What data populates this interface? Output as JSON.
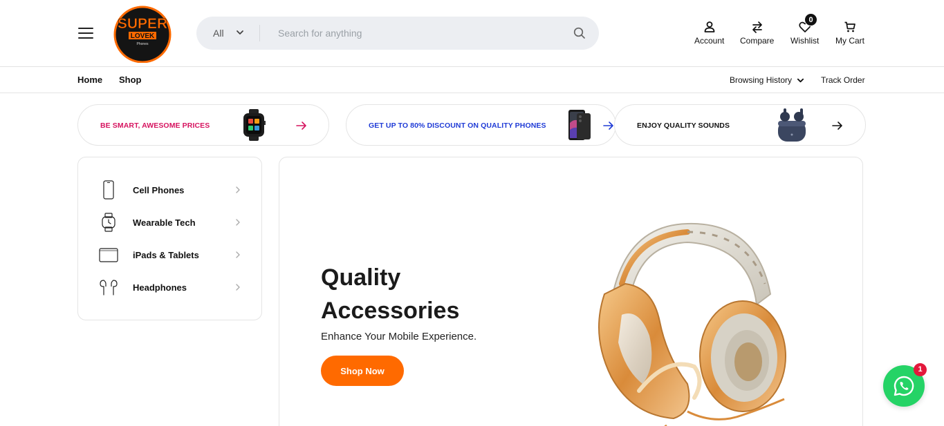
{
  "header": {
    "logo_text": {
      "line1": "SUPER",
      "line2": "LOVEK",
      "line3": "Phones"
    },
    "search": {
      "category": "All",
      "placeholder": "Search for anything"
    },
    "actions": {
      "account": "Account",
      "compare": "Compare",
      "wishlist": "Wishlist",
      "wishlist_count": "0",
      "cart": "My Cart"
    }
  },
  "nav": {
    "home": "Home",
    "shop": "Shop",
    "browsing_history": "Browsing History",
    "track_order": "Track Order"
  },
  "promos": [
    {
      "text": "BE SMART, AWESOME PRICES",
      "color": "#d6135f"
    },
    {
      "text": "GET UP TO 80% DISCOUNT ON QUALITY PHONES",
      "color": "#1f3bd6"
    },
    {
      "text": "ENJOY QUALITY SOUNDS",
      "color": "#111111"
    }
  ],
  "categories": [
    {
      "label": "Cell Phones",
      "icon": "phone-icon"
    },
    {
      "label": "Wearable Tech",
      "icon": "watch-icon"
    },
    {
      "label": "iPads & Tablets",
      "icon": "tablet-icon"
    },
    {
      "label": "Headphones",
      "icon": "earbuds-icon"
    }
  ],
  "hero": {
    "title_line1": "Quality",
    "title_line2": "Accessories",
    "subtitle": "Enhance Your Mobile Experience.",
    "cta": "Shop Now",
    "accent": "#ff6a00"
  },
  "chat": {
    "icon": "whatsapp-icon",
    "count": "1",
    "color": "#25d366"
  }
}
